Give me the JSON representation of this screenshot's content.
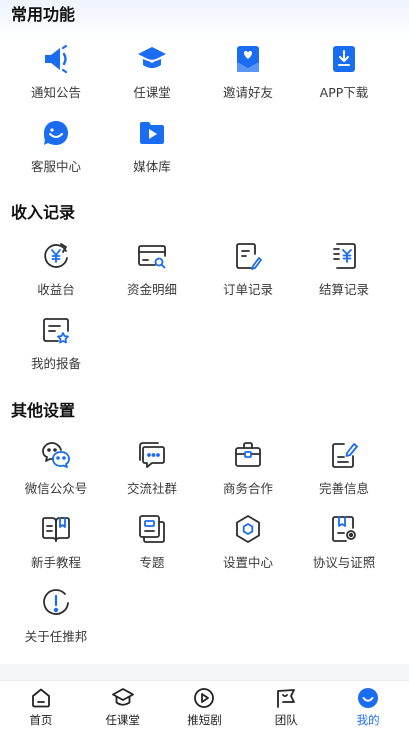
{
  "colors": {
    "accent": "#1a6cf0",
    "icon_stroke": "#2e2e2e",
    "divider": "#f4f5f7"
  },
  "sections": [
    {
      "title": "常用功能",
      "items": [
        {
          "label": "通知公告",
          "icon": "megaphone-icon"
        },
        {
          "label": "任课堂",
          "icon": "graduation-cap-icon"
        },
        {
          "label": "邀请好友",
          "icon": "invite-heart-icon"
        },
        {
          "label": "APP下载",
          "icon": "download-icon"
        },
        {
          "label": "客服中心",
          "icon": "customer-service-icon"
        },
        {
          "label": "媒体库",
          "icon": "media-folder-icon"
        }
      ]
    },
    {
      "title": "收入记录",
      "items": [
        {
          "label": "收益台",
          "icon": "yuan-refresh-icon"
        },
        {
          "label": "资金明细",
          "icon": "card-search-icon"
        },
        {
          "label": "订单记录",
          "icon": "order-edit-icon"
        },
        {
          "label": "结算记录",
          "icon": "settlement-icon"
        },
        {
          "label": "我的报备",
          "icon": "report-icon"
        }
      ]
    },
    {
      "title": "其他设置",
      "items": [
        {
          "label": "微信公众号",
          "icon": "wechat-icon"
        },
        {
          "label": "交流社群",
          "icon": "chat-group-icon"
        },
        {
          "label": "商务合作",
          "icon": "briefcase-icon"
        },
        {
          "label": "完善信息",
          "icon": "edit-info-icon"
        },
        {
          "label": "新手教程",
          "icon": "book-icon"
        },
        {
          "label": "专题",
          "icon": "topic-icon"
        },
        {
          "label": "设置中心",
          "icon": "settings-hexagon-icon"
        },
        {
          "label": "协议与证照",
          "icon": "certificate-icon"
        },
        {
          "label": "关于任推邦",
          "icon": "info-icon"
        }
      ]
    }
  ],
  "tabbar": [
    {
      "label": "首页",
      "icon": "home-icon",
      "active": false
    },
    {
      "label": "任课堂",
      "icon": "graduation-cap-icon",
      "active": false
    },
    {
      "label": "推短剧",
      "icon": "play-circle-icon",
      "active": false
    },
    {
      "label": "团队",
      "icon": "team-flag-icon",
      "active": false
    },
    {
      "label": "我的",
      "icon": "profile-smile-icon",
      "active": true
    }
  ]
}
